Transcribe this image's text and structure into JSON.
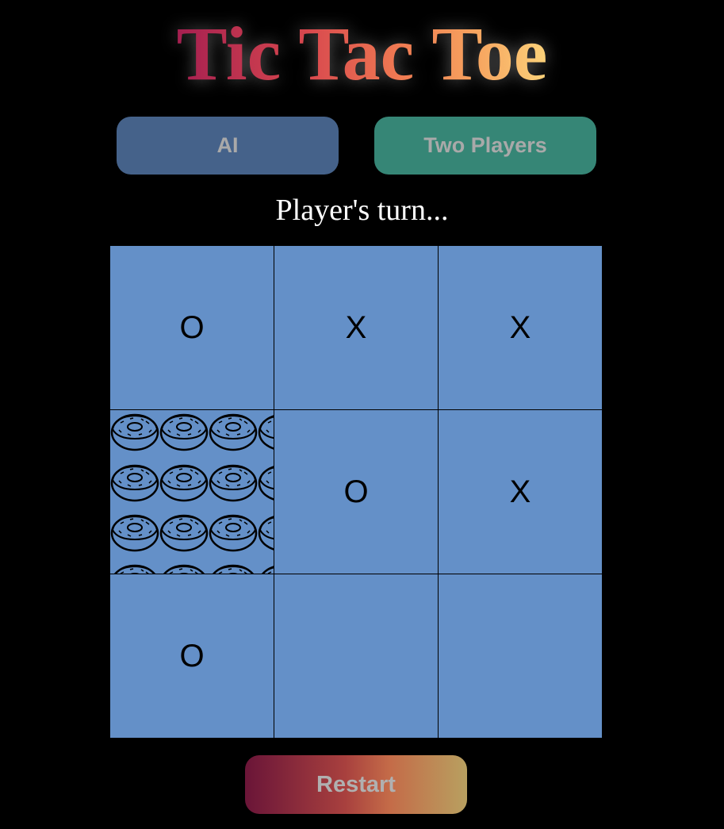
{
  "title": "Tic Tac Toe",
  "modes": {
    "ai_label": "AI",
    "two_players_label": "Two Players"
  },
  "status": "Player's turn...",
  "board": {
    "cells": [
      "O",
      "X",
      "X",
      "",
      "O",
      "X",
      "O",
      "",
      ""
    ],
    "patterned_cell": "donut-pattern-icon"
  },
  "restart_label": "Restart",
  "colors": {
    "background": "#000000",
    "cell": "#6490c8",
    "ai_button": "#45628a",
    "two_players_button": "#368676"
  }
}
